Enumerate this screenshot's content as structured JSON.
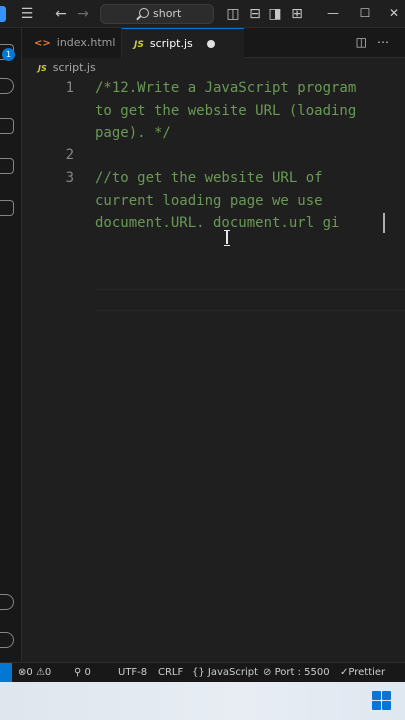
{
  "window": {
    "search_text": "short"
  },
  "activity_bar": {
    "explorer_badge": "1"
  },
  "tabs": [
    {
      "label": "index.html",
      "icon": "html-file-icon",
      "active": false
    },
    {
      "label": "script.js",
      "icon": "js-file-icon",
      "active": true,
      "modified": true
    }
  ],
  "breadcrumb": {
    "file": "script.js"
  },
  "editor": {
    "lines": [
      {
        "number": "1",
        "wrapped": [
          "/*12.Write a JavaScript program",
          "to get the website URL (loading",
          "page). */"
        ]
      },
      {
        "number": "2",
        "wrapped": [
          ""
        ]
      },
      {
        "number": "3",
        "wrapped": [
          "//to get the website URL of",
          "current loading page we use",
          "document.URL. document.url gi"
        ]
      }
    ]
  },
  "statusbar": {
    "errors": "0",
    "warnings": "0",
    "ports_count": "0",
    "encoding": "UTF-8",
    "eol": "CRLF",
    "language": "JavaScript",
    "port": "Port : 5500",
    "formatter": "Prettier"
  },
  "colors": {
    "accent": "#0078d4",
    "comment": "#6a9955",
    "line_number": "#858585",
    "background": "#1f1f1f"
  }
}
